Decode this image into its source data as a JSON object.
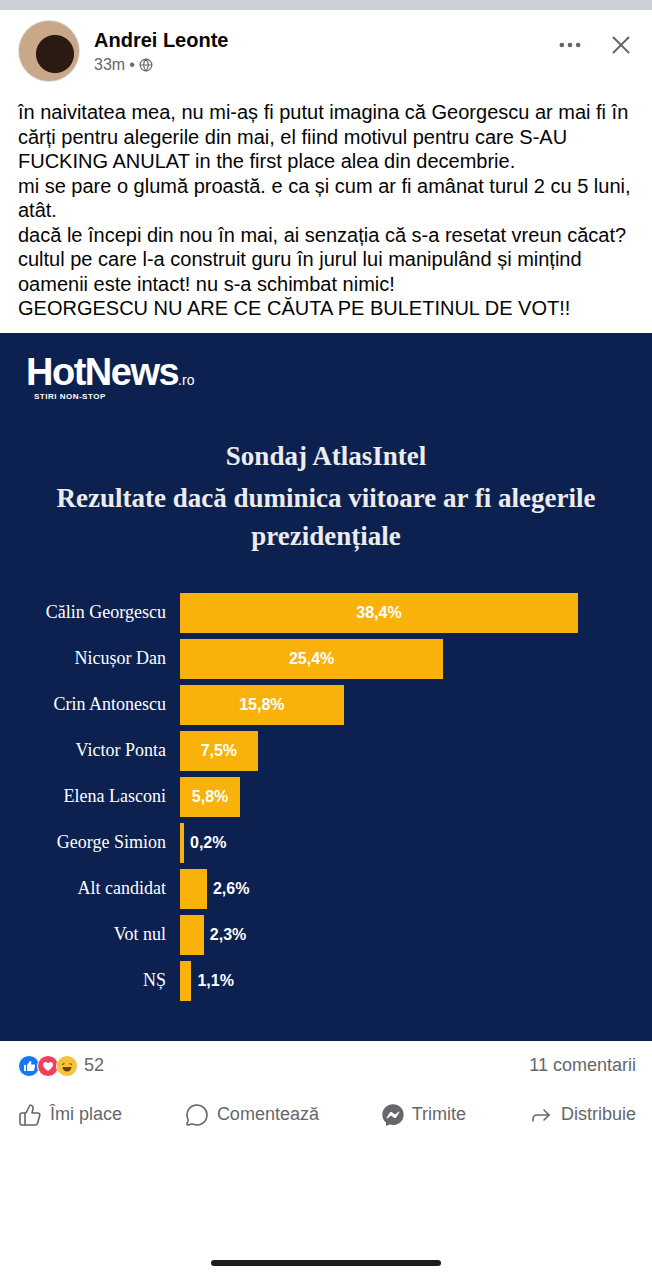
{
  "post": {
    "author": "Andrei Leonte",
    "time": "33m",
    "separator": "•",
    "paragraphs": [
      "în naivitatea mea, nu mi-aș fi putut imagina că Georgescu ar mai fi în cărți pentru alegerile din mai, el fiind motivul pentru care S-AU FUCKING ANULAT in the first place alea din decembrie.",
      "mi se pare o glumă proastă. e ca și cum ar fi amânat turul 2 cu 5 luni, atât.",
      "dacă le începi din nou în mai, ai senzația că s-a resetat vreun căcat? cultul pe care l-a construit guru în jurul lui manipulând și mințind oamenii este intact! nu s-a schimbat nimic!",
      "GEORGESCU NU ARE CE CĂUTA PE BULETINUL DE VOT!!"
    ]
  },
  "chart": {
    "logo": {
      "name": "HotNews",
      "suffix": ".ro",
      "tagline": "STIRI NON-STOP"
    },
    "title": "Sondaj AtlasIntel",
    "subtitle": "Rezultate dacă duminica viitoare ar fi alegerile prezidențiale",
    "rows": [
      {
        "label": "Călin Georgescu",
        "value": 38.4,
        "reading": "38,4%"
      },
      {
        "label": "Nicușor Dan",
        "value": 25.4,
        "reading": "25,4%"
      },
      {
        "label": "Crin Antonescu",
        "value": 15.8,
        "reading": "15,8%"
      },
      {
        "label": "Victor Ponta",
        "value": 7.5,
        "reading": "7,5%"
      },
      {
        "label": "Elena Lasconi",
        "value": 5.8,
        "reading": "5,8%"
      },
      {
        "label": "George Simion",
        "value": 0.2,
        "reading": "0,2%"
      },
      {
        "label": "Alt candidat",
        "value": 2.6,
        "reading": "2,6%"
      },
      {
        "label": "Vot nul",
        "value": 2.3,
        "reading": "2,3%"
      },
      {
        "label": "NȘ",
        "value": 1.1,
        "reading": "1,1%"
      }
    ]
  },
  "reactions": {
    "count": "52",
    "comments": "11 comentarii"
  },
  "actions": [
    {
      "label": "Îmi place",
      "kind": "like"
    },
    {
      "label": "Comentează",
      "kind": "comment"
    },
    {
      "label": "Trimite",
      "kind": "send"
    },
    {
      "label": "Distribuie",
      "kind": "share"
    }
  ]
}
